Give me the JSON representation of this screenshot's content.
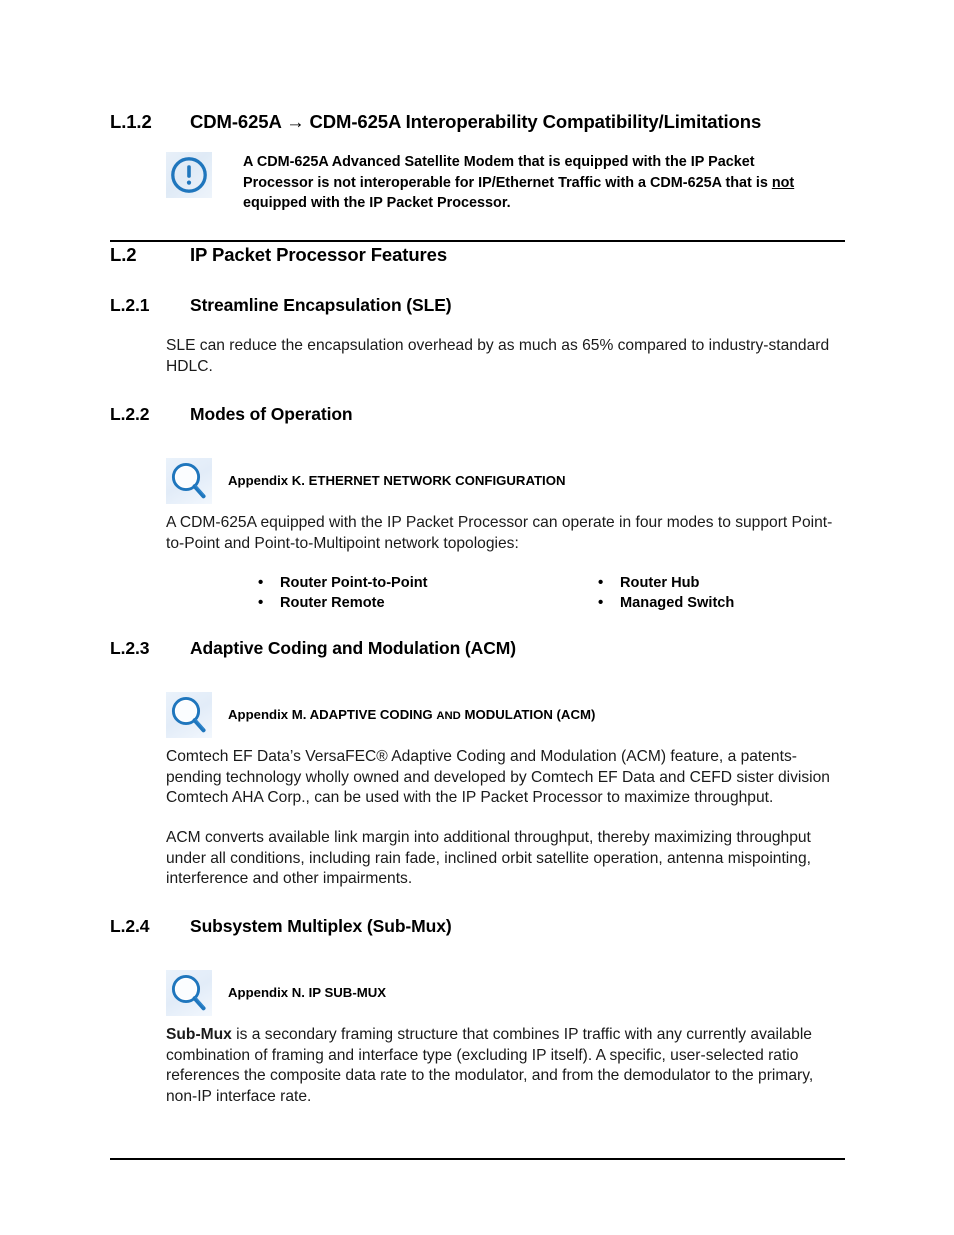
{
  "document": {
    "sections": [
      {
        "id": "l12",
        "number": "L.1.2",
        "title": "CDM-625A → CDM-625A Interoperability Compatibility/Limitations",
        "level": "h2"
      },
      {
        "id": "l2",
        "number": "L.2",
        "title": "IP Packet Processor Features",
        "level": "h2"
      },
      {
        "id": "l21",
        "number": "L.2.1",
        "title": "Streamline Encapsulation (SLE)",
        "level": "h3"
      },
      {
        "id": "l22",
        "number": "L.2.2",
        "title": "Modes of Operation",
        "level": "h3"
      },
      {
        "id": "l23",
        "number": "L.2.3",
        "title": "Adaptive Coding and Modulation (ACM)",
        "level": "h3"
      },
      {
        "id": "l24",
        "number": "L.2.4",
        "title": "Subsystem Multiplex (Sub-Mux)",
        "level": "h3"
      }
    ],
    "warning_note": {
      "icon": "exclamation-circle-icon",
      "line1": "A CDM-625A Advanced Satellite Modem that is equipped with the IP Packet",
      "line2_a": "Processor is not interoperable for IP/Ethernet Traffic with a CDM-625A that is ",
      "line2_underlined": "not",
      "line3": "equipped with the IP Packet Processor."
    },
    "sle_paragraph": "SLE can reduce the encapsulation overhead by as much as 65% compared to industry-standard HDLC.",
    "crossref_k": {
      "icon": "magnifier-icon",
      "text": "Appendix K. ETHERNET NETWORK CONFIGURATION"
    },
    "modes_paragraph": "A CDM-625A equipped with the IP Packet Processor can operate in four modes to support Point-to-Point and Point-to-Multipoint network topologies:",
    "modes_list_left": [
      "Router Point-to-Point",
      "Router Remote"
    ],
    "modes_list_right": [
      "Router Hub",
      "Managed Switch"
    ],
    "bullet_glyph": "•",
    "crossref_m": {
      "icon": "magnifier-icon",
      "prefix": "Appendix M. ADAPTIVE CODING ",
      "smallcaps": "AND",
      "suffix": " MODULATION (ACM)"
    },
    "acm_paragraph_1": "Comtech EF Data’s VersaFEC® Adaptive Coding and Modulation (ACM) feature, a patents-pending technology wholly owned and developed by Comtech EF Data and CEFD sister division Comtech AHA Corp., can be used with the IP Packet Processor to maximize throughput.",
    "acm_paragraph_2": "ACM converts available link margin into additional throughput, thereby maximizing throughput under all conditions, including rain fade, inclined orbit satellite operation, antenna mispointing, interference and other impairments.",
    "crossref_n": {
      "icon": "magnifier-icon",
      "text": "Appendix N. IP SUB-MUX"
    },
    "submux_paragraph_bold_lead": "Sub-Mux",
    "submux_paragraph_rest": " is a secondary framing structure that combines IP traffic with any currently available combination of framing and interface type (excluding IP itself). A specific, user-selected ratio references the composite data rate to the modulator, and from the demodulator to the primary, non-IP interface rate."
  },
  "colors": {
    "icon_blue": "#1f76bd",
    "icon_blue_dark": "#15629f",
    "icon_bg": "#e6eff9",
    "rule_black": "#000000",
    "text_black": "#000000",
    "body_text": "#1a1a1a"
  }
}
